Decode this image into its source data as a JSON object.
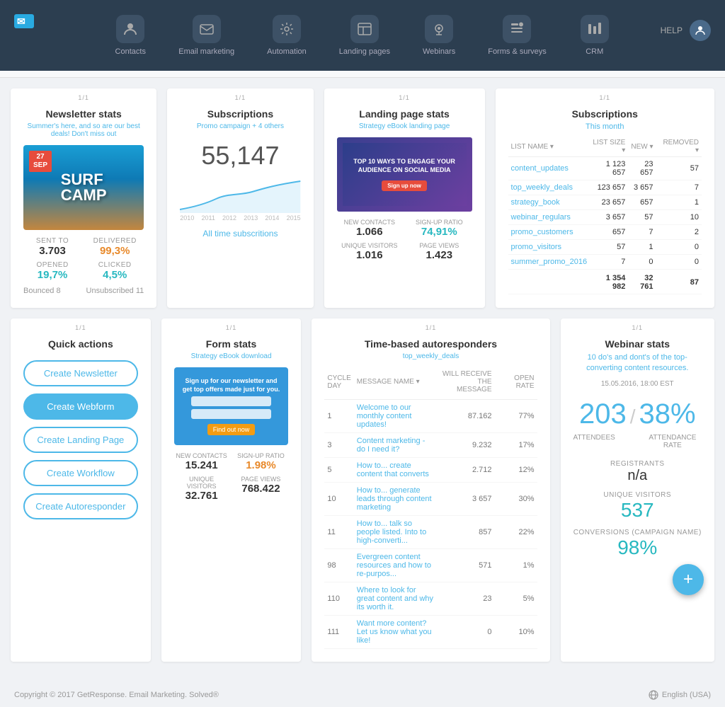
{
  "nav": {
    "items": [
      {
        "id": "contacts",
        "label": "Contacts",
        "icon": "person"
      },
      {
        "id": "email-marketing",
        "label": "Email marketing",
        "icon": "email"
      },
      {
        "id": "automation",
        "label": "Automation",
        "icon": "gear"
      },
      {
        "id": "landing-pages",
        "label": "Landing pages",
        "icon": "layout"
      },
      {
        "id": "webinars",
        "label": "Webinars",
        "icon": "webcam"
      },
      {
        "id": "forms-surveys",
        "label": "Forms & surveys",
        "icon": "forms"
      },
      {
        "id": "crm",
        "label": "CRM",
        "icon": "crm"
      }
    ],
    "help": "HELP",
    "logo_alt": "GetResponse"
  },
  "newsletter": {
    "widget_label": "1/1",
    "title": "Newsletter stats",
    "subtitle": "Summer's here, and so are our best deals! Don't miss out",
    "date_month": "SEP",
    "date_day": "27",
    "sent_to_label": "SENT TO",
    "sent_to_val": "3.703",
    "delivered_label": "DELIVERED",
    "delivered_val": "99,3%",
    "opened_label": "OPENED",
    "opened_val": "19,7%",
    "clicked_label": "CLICKED",
    "clicked_val": "4,5%",
    "bounced_label": "Bounced",
    "bounced_val": "8",
    "unsubscribed_label": "Unsubscribed",
    "unsubscribed_val": "11"
  },
  "subscriptions_chart": {
    "widget_label": "1/1",
    "title": "Subscriptions",
    "subtitle": "Promo campaign + 4 others",
    "big_number": "55,147",
    "all_time_label": "All time subscritions",
    "years": [
      "2010",
      "2011",
      "2012",
      "2013",
      "2014",
      "2015"
    ]
  },
  "landing_page": {
    "widget_label": "1/1",
    "title": "Landing page stats",
    "subtitle": "Strategy eBook landing page",
    "image_text": "TOP 10 WAYS TO ENGAGE YOUR AUDIENCE ON SOCIAL MEDIA",
    "new_contacts_label": "NEW CONTACTS",
    "new_contacts_val": "1.066",
    "signup_ratio_label": "SIGN-UP RATIO",
    "signup_ratio_val": "74,91%",
    "unique_visitors_label": "UNIQUE VISITORS",
    "unique_visitors_val": "1.016",
    "page_views_label": "PAGE VIEWS",
    "page_views_val": "1.423"
  },
  "subscriptions_table": {
    "widget_label": "1/1",
    "title": "Subscriptions",
    "period": "This month",
    "cols": [
      "LIST NAME",
      "LIST SIZE",
      "NEW",
      "REMOVED"
    ],
    "rows": [
      {
        "name": "content_updates",
        "size": "1 123 657",
        "new": "23 657",
        "removed": "57"
      },
      {
        "name": "top_weekly_deals",
        "size": "123 657",
        "new": "3 657",
        "removed": "7"
      },
      {
        "name": "strategy_book",
        "size": "23 657",
        "new": "657",
        "removed": "1"
      },
      {
        "name": "webinar_regulars",
        "size": "3 657",
        "new": "57",
        "removed": "10"
      },
      {
        "name": "promo_customers",
        "size": "657",
        "new": "7",
        "removed": "2"
      },
      {
        "name": "promo_visitors",
        "size": "57",
        "new": "1",
        "removed": "0"
      },
      {
        "name": "summer_promo_2016",
        "size": "7",
        "new": "0",
        "removed": "0"
      }
    ],
    "totals": {
      "size": "1 354 982",
      "new": "32 761",
      "removed": "87"
    }
  },
  "quick_actions": {
    "widget_label": "1/1",
    "title": "Quick actions",
    "buttons": [
      {
        "id": "create-newsletter",
        "label": "Create Newsletter",
        "active": false
      },
      {
        "id": "create-webform",
        "label": "Create Webform",
        "active": true
      },
      {
        "id": "create-landing-page",
        "label": "Create Landing Page",
        "active": false
      },
      {
        "id": "create-workflow",
        "label": "Create Workflow",
        "active": false
      },
      {
        "id": "create-autoresponder",
        "label": "Create Autoresponder",
        "active": false
      }
    ]
  },
  "form_stats": {
    "widget_label": "1/1",
    "title": "Form stats",
    "subtitle": "Strategy eBook download",
    "form_text": "Sign up for our newsletter and get top offers made just for you.",
    "new_contacts_label": "NEW CONTACTS",
    "new_contacts_val": "15.241",
    "signup_ratio_label": "SIGN-UP RATIO",
    "signup_ratio_val": "1.98%",
    "unique_visitors_label": "UNIQUE VISITORS",
    "unique_visitors_val": "32.761",
    "page_views_label": "PAGE VIEWS",
    "page_views_val": "768.422"
  },
  "autoresponders": {
    "widget_label": "1/1",
    "title": "Time-based autoresponders",
    "subtitle": "top_weekly_deals",
    "cols": [
      "CYCLE DAY",
      "MESSAGE NAME",
      "WILL RECEIVE THE MESSAGE",
      "OPEN RATE"
    ],
    "rows": [
      {
        "day": "1",
        "name": "Welcome to our monthly content updates!",
        "will_receive": "87.162",
        "open_rate": "77%"
      },
      {
        "day": "3",
        "name": "Content marketing - do I need it?",
        "will_receive": "9.232",
        "open_rate": "17%"
      },
      {
        "day": "5",
        "name": "How to... create content that converts",
        "will_receive": "2.712",
        "open_rate": "12%"
      },
      {
        "day": "10",
        "name": "How to... generate leads through content marketing",
        "will_receive": "3 657",
        "open_rate": "30%"
      },
      {
        "day": "11",
        "name": "How to... talk so people listed. Into to high-converti...",
        "will_receive": "857",
        "open_rate": "22%"
      },
      {
        "day": "98",
        "name": "Evergreen content resources and how to re-purpos...",
        "will_receive": "571",
        "open_rate": "1%"
      },
      {
        "day": "110",
        "name": "Where to look for great content and why its worth it.",
        "will_receive": "23",
        "open_rate": "5%"
      },
      {
        "day": "111",
        "name": "Want more content? Let us know what you like!",
        "will_receive": "0",
        "open_rate": "10%"
      }
    ]
  },
  "webinar": {
    "widget_label": "1/1",
    "title": "Webinar stats",
    "description": "10 do's and dont's of the top-converting content resources.",
    "date": "15.05.2016, 18:00 EST",
    "attendees": "203",
    "attendance_rate": "38%",
    "attendees_label": "ATTENDEES",
    "attendance_label": "ATTENDANCE RATE",
    "registrants_label": "REGISTRANTS",
    "registrants_val": "n/a",
    "unique_visitors_label": "UNIQUE VISITORS",
    "unique_visitors_val": "537",
    "conversions_label": "CONVERSIONS (CAMPAIGN NAME)",
    "conversions_val": "98%"
  },
  "footer": {
    "copyright": "Copyright © 2017 GetResponse. Email Marketing. Solved®",
    "language": "English (USA)"
  },
  "fab": {
    "label": "+"
  }
}
